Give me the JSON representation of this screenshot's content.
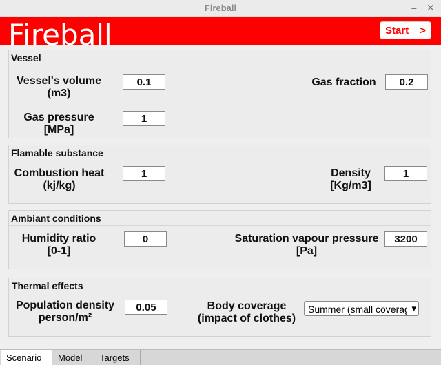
{
  "window": {
    "title": "Fireball",
    "minimize": "–",
    "close": "✕"
  },
  "header": {
    "logo": "Fireball",
    "start_label": "Start",
    "start_chevron": ">",
    "bg_color": "#ff0000"
  },
  "vessel": {
    "title": "Vessel",
    "volume_label_1": "Vessel's volume",
    "volume_label_2": "(m3)",
    "volume_value": "0.1",
    "gas_fraction_label": "Gas fraction",
    "gas_fraction_value": "0.2",
    "pressure_label_1": "Gas pressure",
    "pressure_label_2": "[MPa]",
    "pressure_value": "1"
  },
  "flamable": {
    "title": "Flamable substance",
    "heat_label_1": "Combustion heat",
    "heat_label_2": "(kj/kg)",
    "heat_value": "1",
    "density_label_1": "Density",
    "density_label_2": "[Kg/m3]",
    "density_value": "1"
  },
  "ambiant": {
    "title": "Ambiant conditions",
    "humidity_label_1": "Humidity ratio",
    "humidity_label_2": "[0-1]",
    "humidity_value": "0",
    "svp_label_1": "Saturation vapour pressure",
    "svp_label_2": "[Pa]",
    "svp_value": "3200"
  },
  "thermal": {
    "title": "Thermal effects",
    "pop_label_1": "Population density",
    "pop_label_2": "person/m²",
    "pop_value": "0.05",
    "body_label_1": "Body coverage",
    "body_label_2": "(impact of clothes)",
    "body_value": "Summer (small coverage)",
    "body_arrow": "▾"
  },
  "tabs": [
    "Scenario",
    "Model",
    "Targets"
  ]
}
